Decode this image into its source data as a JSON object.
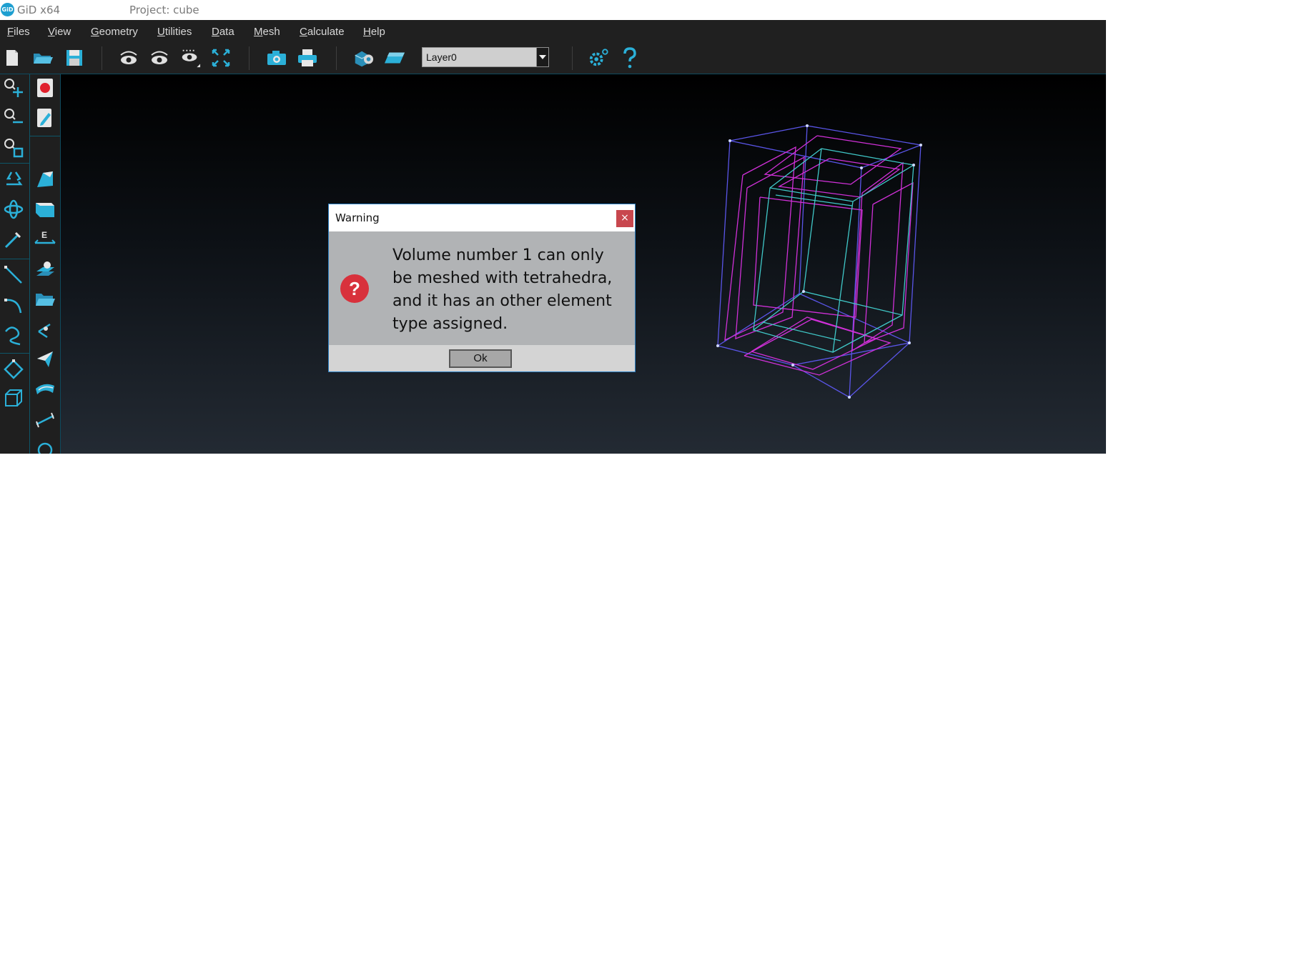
{
  "window": {
    "logo_text": "GiD",
    "app_title": "GiD x64",
    "project_label": "Project: cube"
  },
  "menu": [
    "Files",
    "View",
    "Geometry",
    "Utilities",
    "Data",
    "Mesh",
    "Calculate",
    "Help"
  ],
  "toolbar": {
    "layer_value": "Layer0",
    "icons": [
      "new-file-icon",
      "open-folder-icon",
      "save-icon",
      "rotate-view-icon",
      "rotate-view-icon",
      "view-options-icon",
      "zoom-frame-icon",
      "camera-icon",
      "print-icon",
      "render-icon",
      "layer-plane-icon",
      "settings-icon",
      "help-icon"
    ]
  },
  "sidebar": {
    "icons_left": [
      "zoom-in-icon",
      "zoom-out-icon",
      "zoom-window-icon",
      "redraw-icon",
      "rotate-icon",
      "point-icon",
      "line-icon",
      "arc-icon",
      "spline-icon",
      "surface-icon",
      "volume-icon"
    ],
    "icons_right": [
      "record-icon",
      "edit-icon",
      "surface-tool-icon",
      "volume-tool-icon",
      "entity-label-icon",
      "layers-icon",
      "folder-icon",
      "point-tool-icon",
      "selection-icon",
      "mesh-surface-icon",
      "dimension-icon",
      "circle-icon"
    ]
  },
  "dialog": {
    "title": "Warning",
    "close_glyph": "×",
    "icon_glyph": "?",
    "message": "Volume number 1 can only be meshed with tetrahedra, and it has an other element type assigned.",
    "ok_label": "Ok"
  },
  "colors": {
    "accent": "#1e9fd0",
    "viewport_top": "#000000",
    "viewport_bottom": "#232a33",
    "cube_outer": "#5a55e8",
    "cube_magenta": "#d030d8",
    "cube_cyan": "#40c8c8",
    "dialog_close": "#c8474e",
    "dialog_icon": "#d8313c"
  }
}
